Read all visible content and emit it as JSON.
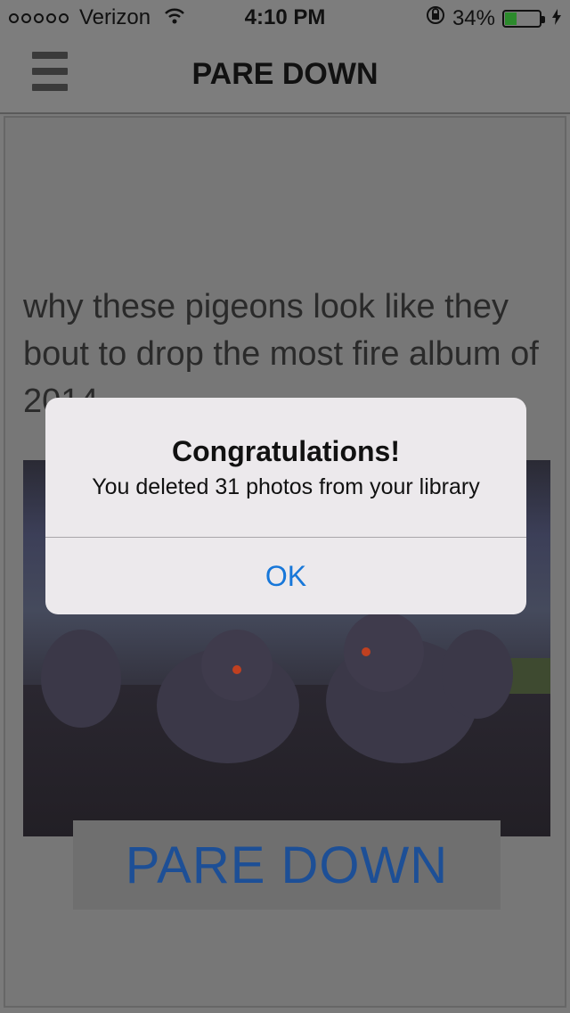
{
  "status_bar": {
    "carrier": "Verizon",
    "time": "4:10 PM",
    "battery_percent": "34%",
    "battery_level": 0.34,
    "signal_dots": 5
  },
  "nav": {
    "title": "PARE DOWN",
    "menu_icon": "hamburger-icon"
  },
  "post": {
    "caption": "why these pigeons look like they bout to drop the most fire album of 2014"
  },
  "brand": {
    "label": "PARE DOWN",
    "color": "#1d4f96"
  },
  "alert": {
    "title": "Congratulations!",
    "message": "You deleted 31 photos from your library",
    "ok_label": "OK",
    "ok_color": "#1777d9"
  }
}
